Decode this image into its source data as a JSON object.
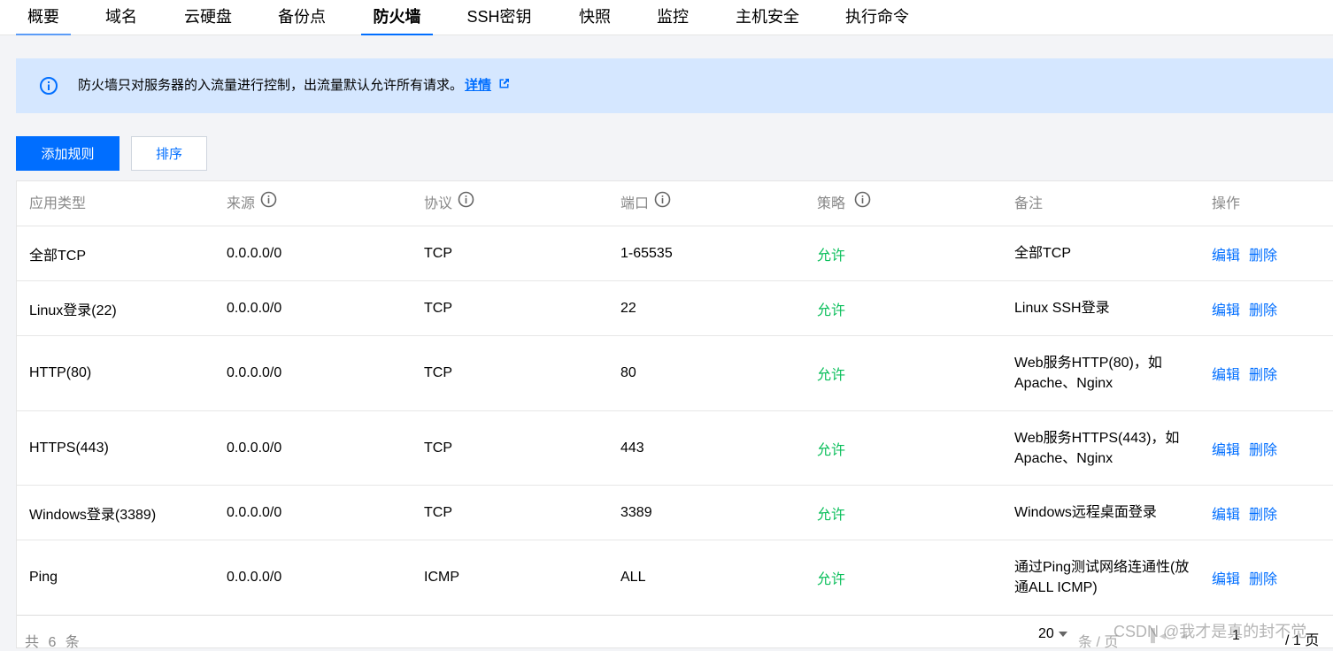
{
  "tabs": [
    "概要",
    "域名",
    "云硬盘",
    "备份点",
    "防火墙",
    "SSH密钥",
    "快照",
    "监控",
    "主机安全",
    "执行命令"
  ],
  "active_tab": "防火墙",
  "notice": {
    "text": "防火墙只对服务器的入流量进行控制，出流量默认允许所有请求。",
    "link": "详情"
  },
  "buttons": {
    "add_rule": "添加规则",
    "sort": "排序"
  },
  "table": {
    "headers": [
      "应用类型",
      "来源",
      "协议",
      "端口",
      "策略",
      "备注",
      "操作"
    ],
    "rows": [
      {
        "type": "全部TCP",
        "source": "0.0.0.0/0",
        "protocol": "TCP",
        "port": "1-65535",
        "policy": "允许",
        "remark": "全部TCP"
      },
      {
        "type": "Linux登录(22)",
        "source": "0.0.0.0/0",
        "protocol": "TCP",
        "port": "22",
        "policy": "允许",
        "remark": "Linux SSH登录"
      },
      {
        "type": "HTTP(80)",
        "source": "0.0.0.0/0",
        "protocol": "TCP",
        "port": "80",
        "policy": "允许",
        "remark": "Web服务HTTP(80)，如 Apache、Nginx"
      },
      {
        "type": "HTTPS(443)",
        "source": "0.0.0.0/0",
        "protocol": "TCP",
        "port": "443",
        "policy": "允许",
        "remark": "Web服务HTTPS(443)，如 Apache、Nginx"
      },
      {
        "type": "Windows登录(3389)",
        "source": "0.0.0.0/0",
        "protocol": "TCP",
        "port": "3389",
        "policy": "允许",
        "remark": "Windows远程桌面登录"
      },
      {
        "type": "Ping",
        "source": "0.0.0.0/0",
        "protocol": "ICMP",
        "port": "ALL",
        "policy": "允许",
        "remark": "通过Ping测试网络连通性(放通ALL ICMP)"
      }
    ],
    "action_edit": "编辑",
    "action_delete": "删除"
  },
  "footer": {
    "total": "共 6 条",
    "page_size": "20",
    "per_page": "条 / 页",
    "current_page": "1",
    "total_pages": "/ 1 页"
  },
  "watermark": "CSDN @我才是真的封不觉",
  "colors": {
    "primary": "#006eff",
    "allow": "#0abf5b",
    "notice_bg": "#d5e7ff"
  }
}
